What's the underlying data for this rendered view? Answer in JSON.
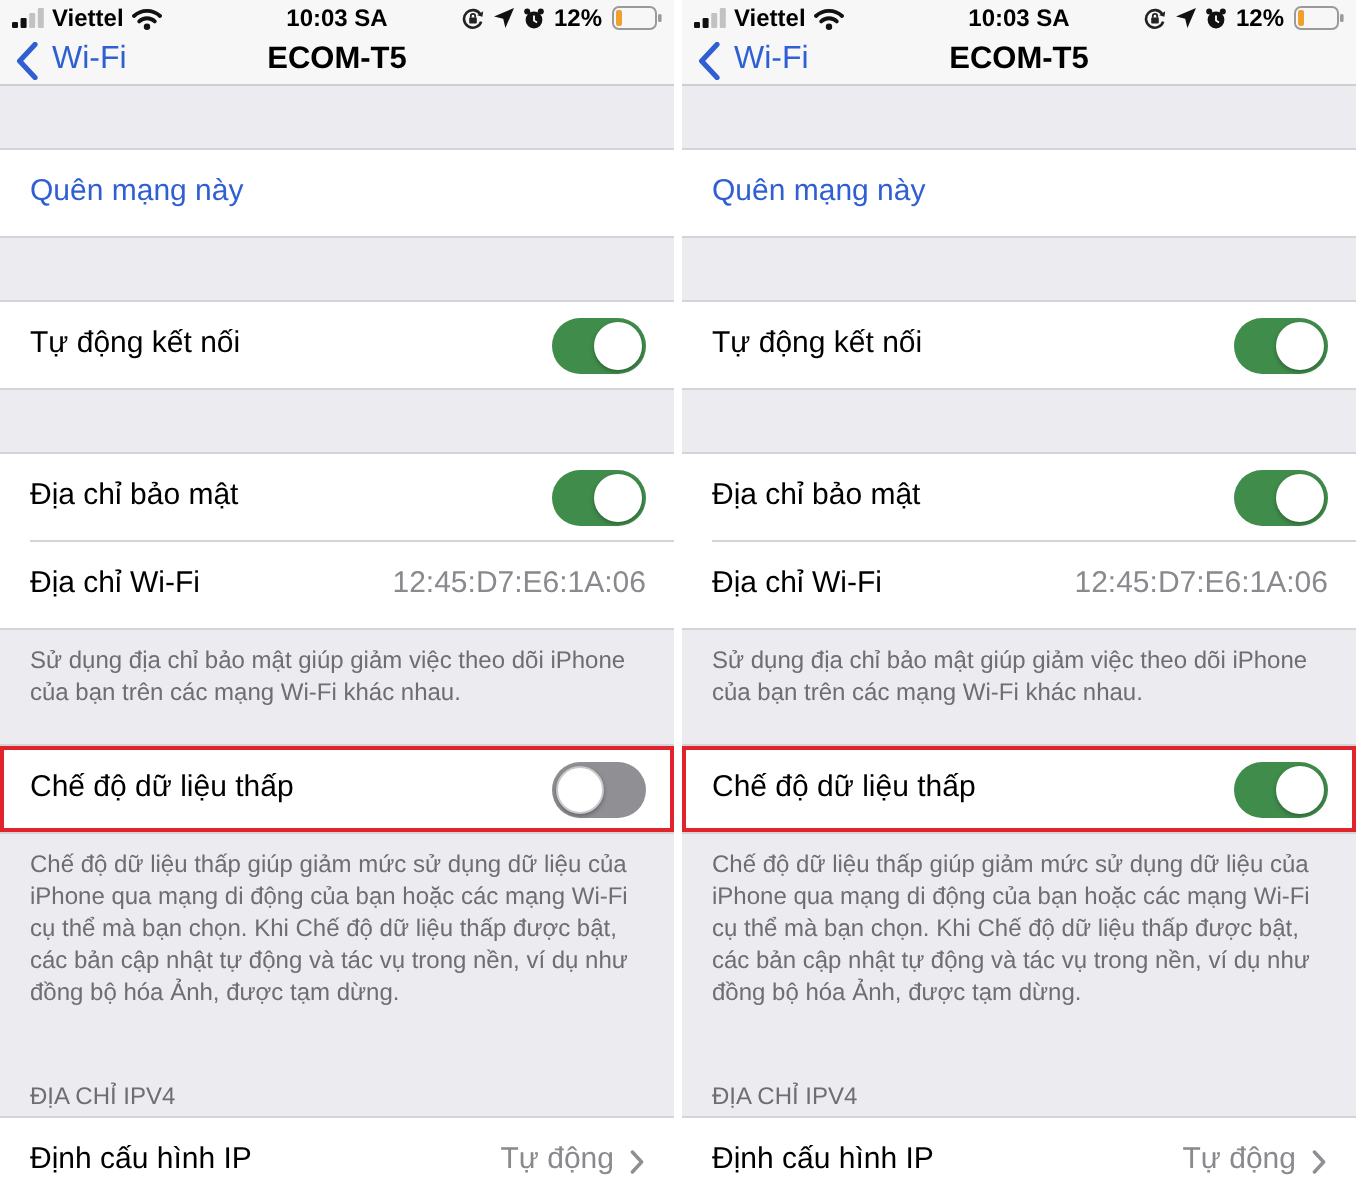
{
  "panels": [
    {
      "status_bar": {
        "carrier": "Viettel",
        "time": "10:03 SA",
        "battery": "12%"
      },
      "nav_bar": {
        "back": "Wi-Fi",
        "title": "ECOM-T5"
      },
      "groups": [
        {
          "rows": [
            {
              "kind": "action",
              "label": "Quên mạng này",
              "highlighted": false
            }
          ]
        },
        {
          "rows": [
            {
              "kind": "toggle",
              "label": "Tự động kết nối",
              "on": true,
              "highlighted": false
            }
          ]
        },
        {
          "rows": [
            {
              "kind": "toggle",
              "label": "Địa chỉ bảo mật",
              "on": true,
              "highlighted": false
            },
            {
              "kind": "value",
              "label": "Địa chỉ Wi-Fi",
              "value": "12:45:D7:E6:1A:06",
              "highlighted": false
            }
          ],
          "footer": "Sử dụng địa chỉ bảo mật giúp giảm việc theo dõi iPhone của bạn trên các mạng Wi-Fi khác nhau."
        },
        {
          "rows": [
            {
              "kind": "toggle",
              "label": "Chế độ dữ liệu thấp",
              "on": false,
              "highlighted": true
            }
          ],
          "footer": "Chế độ dữ liệu thấp giúp giảm mức sử dụng dữ liệu của iPhone qua mạng di động của bạn hoặc các mạng Wi-Fi cụ thể mà bạn chọn. Khi Chế độ dữ liệu thấp được bật, các bản cập nhật tự động và tác vụ trong nền, ví dụ như đồng bộ hóa Ảnh, được tạm dừng."
        },
        {
          "header": "ĐỊA CHỈ IPV4",
          "rows": [
            {
              "kind": "link",
              "label": "Định cấu hình IP",
              "value": "Tự động",
              "highlighted": false
            }
          ]
        }
      ]
    },
    {
      "status_bar": {
        "carrier": "Viettel",
        "time": "10:03 SA",
        "battery": "12%"
      },
      "nav_bar": {
        "back": "Wi-Fi",
        "title": "ECOM-T5"
      },
      "groups": [
        {
          "rows": [
            {
              "kind": "action",
              "label": "Quên mạng này",
              "highlighted": false
            }
          ]
        },
        {
          "rows": [
            {
              "kind": "toggle",
              "label": "Tự động kết nối",
              "on": true,
              "highlighted": false
            }
          ]
        },
        {
          "rows": [
            {
              "kind": "toggle",
              "label": "Địa chỉ bảo mật",
              "on": true,
              "highlighted": false
            },
            {
              "kind": "value",
              "label": "Địa chỉ Wi-Fi",
              "value": "12:45:D7:E6:1A:06",
              "highlighted": false
            }
          ],
          "footer": "Sử dụng địa chỉ bảo mật giúp giảm việc theo dõi iPhone của bạn trên các mạng Wi-Fi khác nhau."
        },
        {
          "rows": [
            {
              "kind": "toggle",
              "label": "Chế độ dữ liệu thấp",
              "on": true,
              "highlighted": true
            }
          ],
          "footer": "Chế độ dữ liệu thấp giúp giảm mức sử dụng dữ liệu của iPhone qua mạng di động của bạn hoặc các mạng Wi-Fi cụ thể mà bạn chọn. Khi Chế độ dữ liệu thấp được bật, các bản cập nhật tự động và tác vụ trong nền, ví dụ như đồng bộ hóa Ảnh, được tạm dừng."
        },
        {
          "header": "ĐỊA CHỈ IPV4",
          "rows": [
            {
              "kind": "link",
              "label": "Định cấu hình IP",
              "value": "Tự động",
              "highlighted": false
            }
          ]
        }
      ]
    }
  ]
}
